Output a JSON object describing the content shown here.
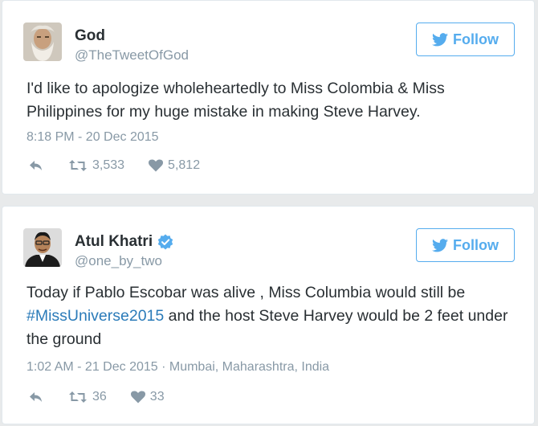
{
  "tweets": [
    {
      "name": "God",
      "handle": "@TheTweetOfGod",
      "follow_label": "Follow",
      "text": "I'd like to apologize wholeheartedly to Miss Colombia & Miss Philippines for my huge mistake in making Steve Harvey.",
      "timestamp": "8:18 PM - 20 Dec 2015",
      "retweets": "3,533",
      "likes": "5,812"
    },
    {
      "name": "Atul Khatri",
      "verified": true,
      "handle": "@one_by_two",
      "follow_label": "Follow",
      "text_before": "Today if Pablo Escobar was alive , Miss Columbia would still be",
      "hashtag": "#MissUniverse2015",
      "text_after": " and the host Steve Harvey would be 2 feet under the ground",
      "timestamp": "1:02 AM - 21 Dec 2015 · Mumbai, Maharashtra, India",
      "retweets": "36",
      "likes": "33"
    }
  ],
  "colors": {
    "twitter_blue": "#55acee",
    "link": "#2b7bb9",
    "text": "#292f33",
    "muted": "#8899a6"
  },
  "icons": [
    "twitter-bird-icon",
    "reply-icon",
    "retweet-icon",
    "heart-icon",
    "verified-badge-icon"
  ]
}
